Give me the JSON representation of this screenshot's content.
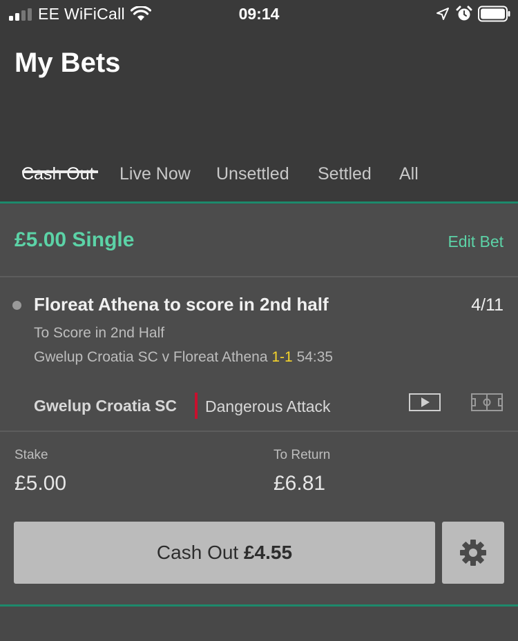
{
  "status_bar": {
    "carrier": "EE WiFiCall",
    "time": "09:14",
    "icons": [
      "signal-icon",
      "wifi-icon",
      "location-icon",
      "alarm-icon",
      "battery-icon"
    ]
  },
  "header": {
    "title": "My Bets",
    "tabs": [
      {
        "label": "Cash Out",
        "active": true
      },
      {
        "label": "Live Now",
        "active": false
      },
      {
        "label": "Unsettled",
        "active": false
      },
      {
        "label": "Settled",
        "active": false
      },
      {
        "label": "All",
        "active": false
      }
    ]
  },
  "bet": {
    "heading": "£5.00 Single",
    "edit_label": "Edit Bet",
    "selection": "Floreat Athena to score in 2nd half",
    "odds": "4/11",
    "market": "To Score in 2nd Half",
    "event_name": "Gwelup Croatia SC v Floreat Athena",
    "score": "1-1",
    "match_time": "54:35",
    "live_team": "Gwelup Croatia SC",
    "live_event": "Dangerous Attack",
    "stake_label": "Stake",
    "stake_value": "£5.00",
    "return_label": "To Return",
    "return_value": "£6.81",
    "cashout_label": "Cash Out",
    "cashout_amount": "£4.55"
  },
  "colors": {
    "accent_green": "#5cd3a7",
    "divider_green": "#1d8a6c",
    "score_yellow": "#f6d52b",
    "live_red": "#c8102e"
  }
}
